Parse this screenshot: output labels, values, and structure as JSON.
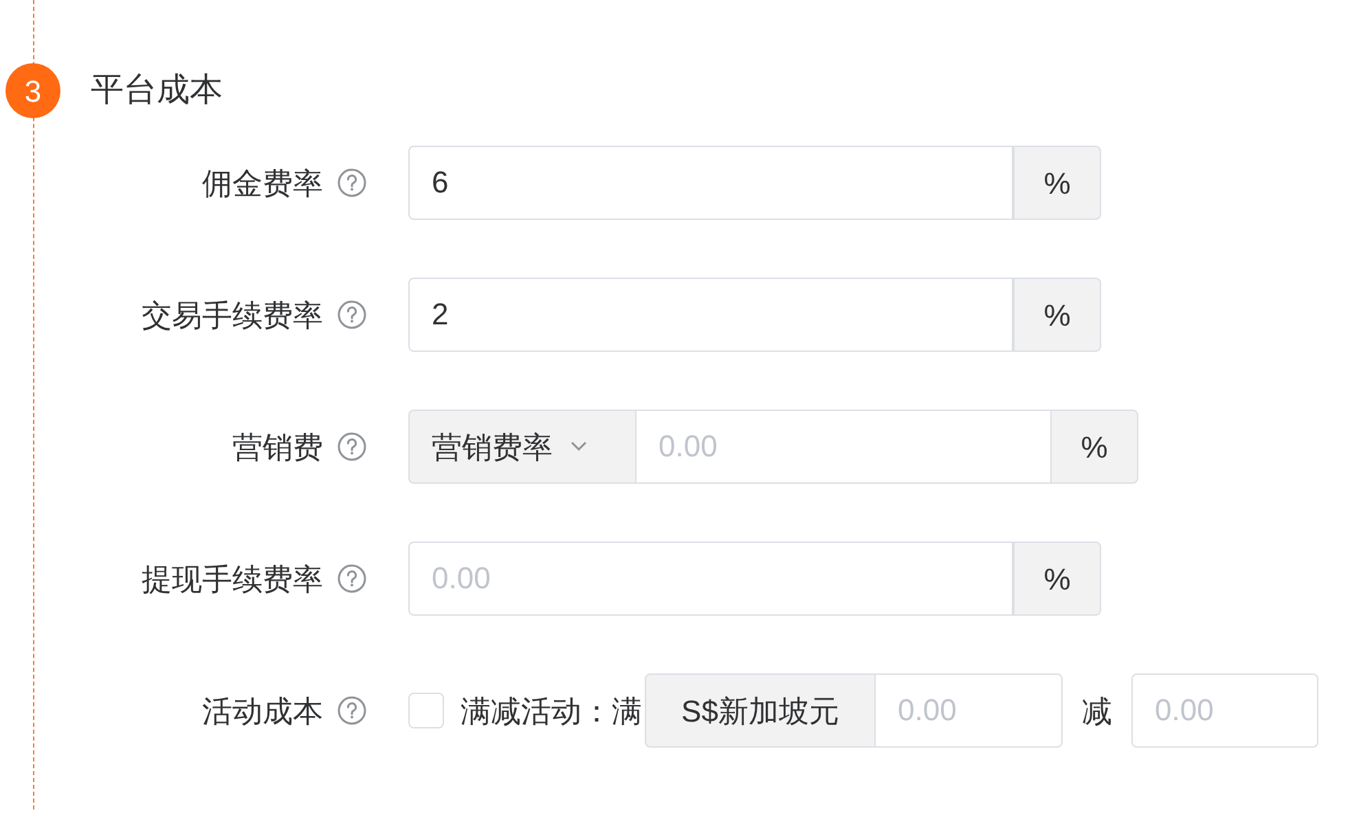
{
  "section": {
    "step": "3",
    "title": "平台成本"
  },
  "fields": [
    {
      "kind": "input",
      "label": "佣金费率",
      "value": "6",
      "suffix": "%"
    },
    {
      "kind": "input",
      "label": "交易手续费率",
      "value": "2",
      "suffix": "%"
    },
    {
      "kind": "select_input",
      "label": "营销费",
      "select": "营销费率",
      "placeholder": "0.00",
      "suffix": "%"
    },
    {
      "kind": "input",
      "label": "提现手续费率",
      "placeholder": "0.00",
      "suffix": "%"
    },
    {
      "kind": "activity",
      "label": "活动成本",
      "checked": false,
      "checkbox_label": "满减活动：",
      "prefix_text": "满",
      "currency": "S$新加坡元",
      "threshold_placeholder": "0.00",
      "minus_text": "减",
      "discount_placeholder": "0.00"
    }
  ]
}
